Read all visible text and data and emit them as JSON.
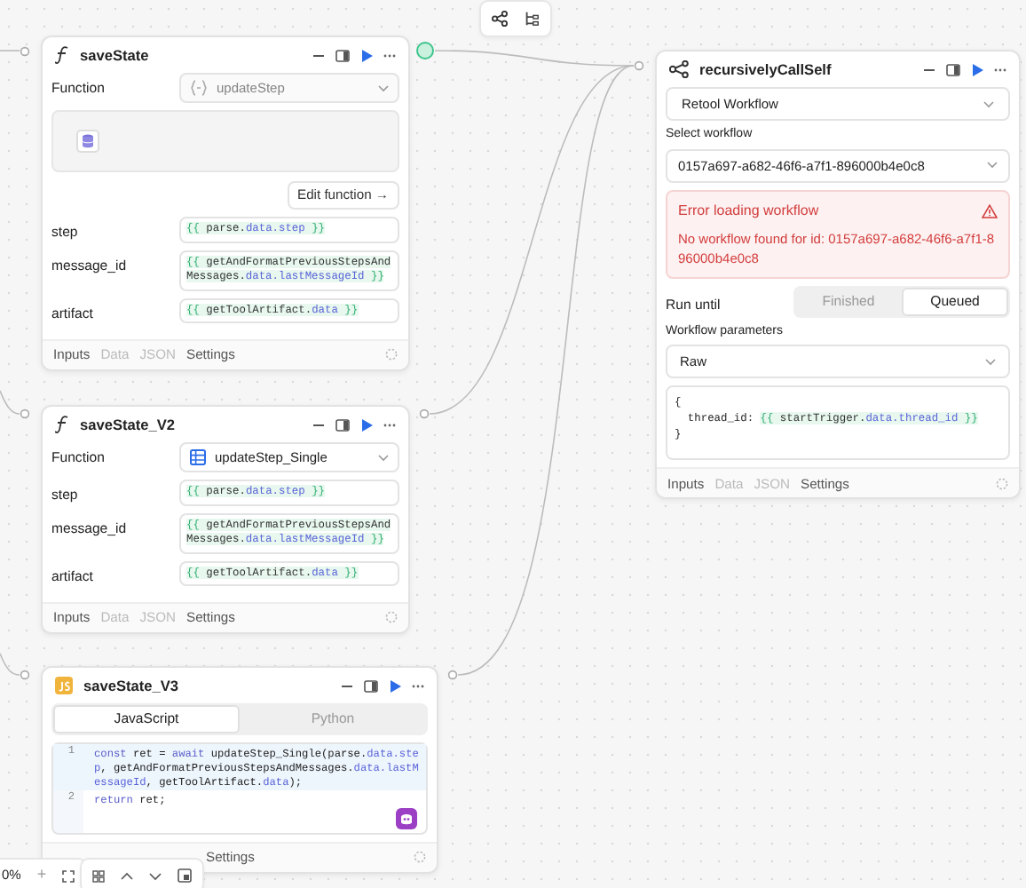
{
  "nodes": [
    {
      "kind": "function",
      "title": "saveState",
      "output_active": true,
      "function": {
        "label": "Function",
        "value": "updateStep",
        "kind": "code",
        "disabled": true
      },
      "edit_button": "Edit function →",
      "params": [
        {
          "name": "step",
          "value": "{{ parse.data.step }}"
        },
        {
          "name": "message_id",
          "value": "{{ getAndFormatPreviousStepsAndMessages.data.lastMessageId }}"
        },
        {
          "name": "artifact",
          "value": "{{ getToolArtifact.data }}"
        }
      ],
      "footer": [
        {
          "label": "Inputs",
          "disabled": false
        },
        {
          "label": "Data",
          "disabled": true
        },
        {
          "label": "JSON",
          "disabled": true
        },
        {
          "label": "Settings",
          "disabled": false
        }
      ]
    },
    {
      "kind": "function",
      "title": "saveState_V2",
      "output_active": false,
      "function": {
        "label": "Function",
        "value": "updateStep_Single",
        "kind": "table",
        "disabled": false
      },
      "params": [
        {
          "name": "step",
          "value": "{{ parse.data.step }}"
        },
        {
          "name": "message_id",
          "value": "{{ getAndFormatPreviousStepsAndMessages.data.lastMessageId }}"
        },
        {
          "name": "artifact",
          "value": "{{ getToolArtifact.data }}"
        }
      ],
      "footer": [
        {
          "label": "Inputs",
          "disabled": false
        },
        {
          "label": "Data",
          "disabled": true
        },
        {
          "label": "JSON",
          "disabled": true
        },
        {
          "label": "Settings",
          "disabled": false
        }
      ]
    },
    {
      "kind": "code",
      "title": "saveState_V3",
      "output_active": false,
      "languages": [
        {
          "label": "JavaScript",
          "selected": true
        },
        {
          "label": "Python",
          "selected": false
        }
      ],
      "code_lines": [
        {
          "number": "1",
          "active": true,
          "tokens": [
            {
              "text": "const",
              "kind": "keyword"
            },
            {
              "text": " ret = ",
              "kind": "plain"
            },
            {
              "text": "await",
              "kind": "keyword"
            },
            {
              "text": " updateStep_Single(parse.",
              "kind": "plain"
            },
            {
              "text": "data.step",
              "kind": "property"
            },
            {
              "text": ", getAndFormatPreviousStepsAndMessages.",
              "kind": "plain"
            },
            {
              "text": "data.lastMessageId",
              "kind": "property"
            },
            {
              "text": ", getToolArtifact.",
              "kind": "plain"
            },
            {
              "text": "data",
              "kind": "property"
            },
            {
              "text": ");",
              "kind": "plain"
            }
          ]
        },
        {
          "number": "2",
          "active": false,
          "tokens": [
            {
              "text": "return",
              "kind": "keyword"
            },
            {
              "text": " ret;",
              "kind": "plain"
            }
          ]
        }
      ],
      "footer": [
        {
          "label": "Settings",
          "disabled": false
        }
      ]
    },
    {
      "kind": "workflow",
      "title": "recursivelyCallSelf",
      "source": "Retool Workflow",
      "select_label": "Select workflow",
      "workflow_id": "0157a697-a682-46f6-a7f1-896000b4e0c8",
      "error": {
        "title": "Error loading workflow",
        "message": "No workflow found for id: 0157a697-a682-46f6-a7f1-896000b4e0c8"
      },
      "run_until": {
        "label": "Run until",
        "options": [
          {
            "label": "Finished",
            "selected": false
          },
          {
            "label": "Queued",
            "selected": true
          }
        ]
      },
      "params_label": "Workflow parameters",
      "params_format": "Raw",
      "params_code": [
        "{",
        "  thread_id: {{ startTrigger.data.thread_id }}",
        "}"
      ],
      "footer": [
        {
          "label": "Inputs",
          "disabled": false
        },
        {
          "label": "Data",
          "disabled": true
        },
        {
          "label": "JSON",
          "disabled": true
        },
        {
          "label": "Settings",
          "disabled": false
        }
      ]
    }
  ],
  "zoom_bar": {
    "zoom": "0%",
    "zoom_in": "+"
  }
}
